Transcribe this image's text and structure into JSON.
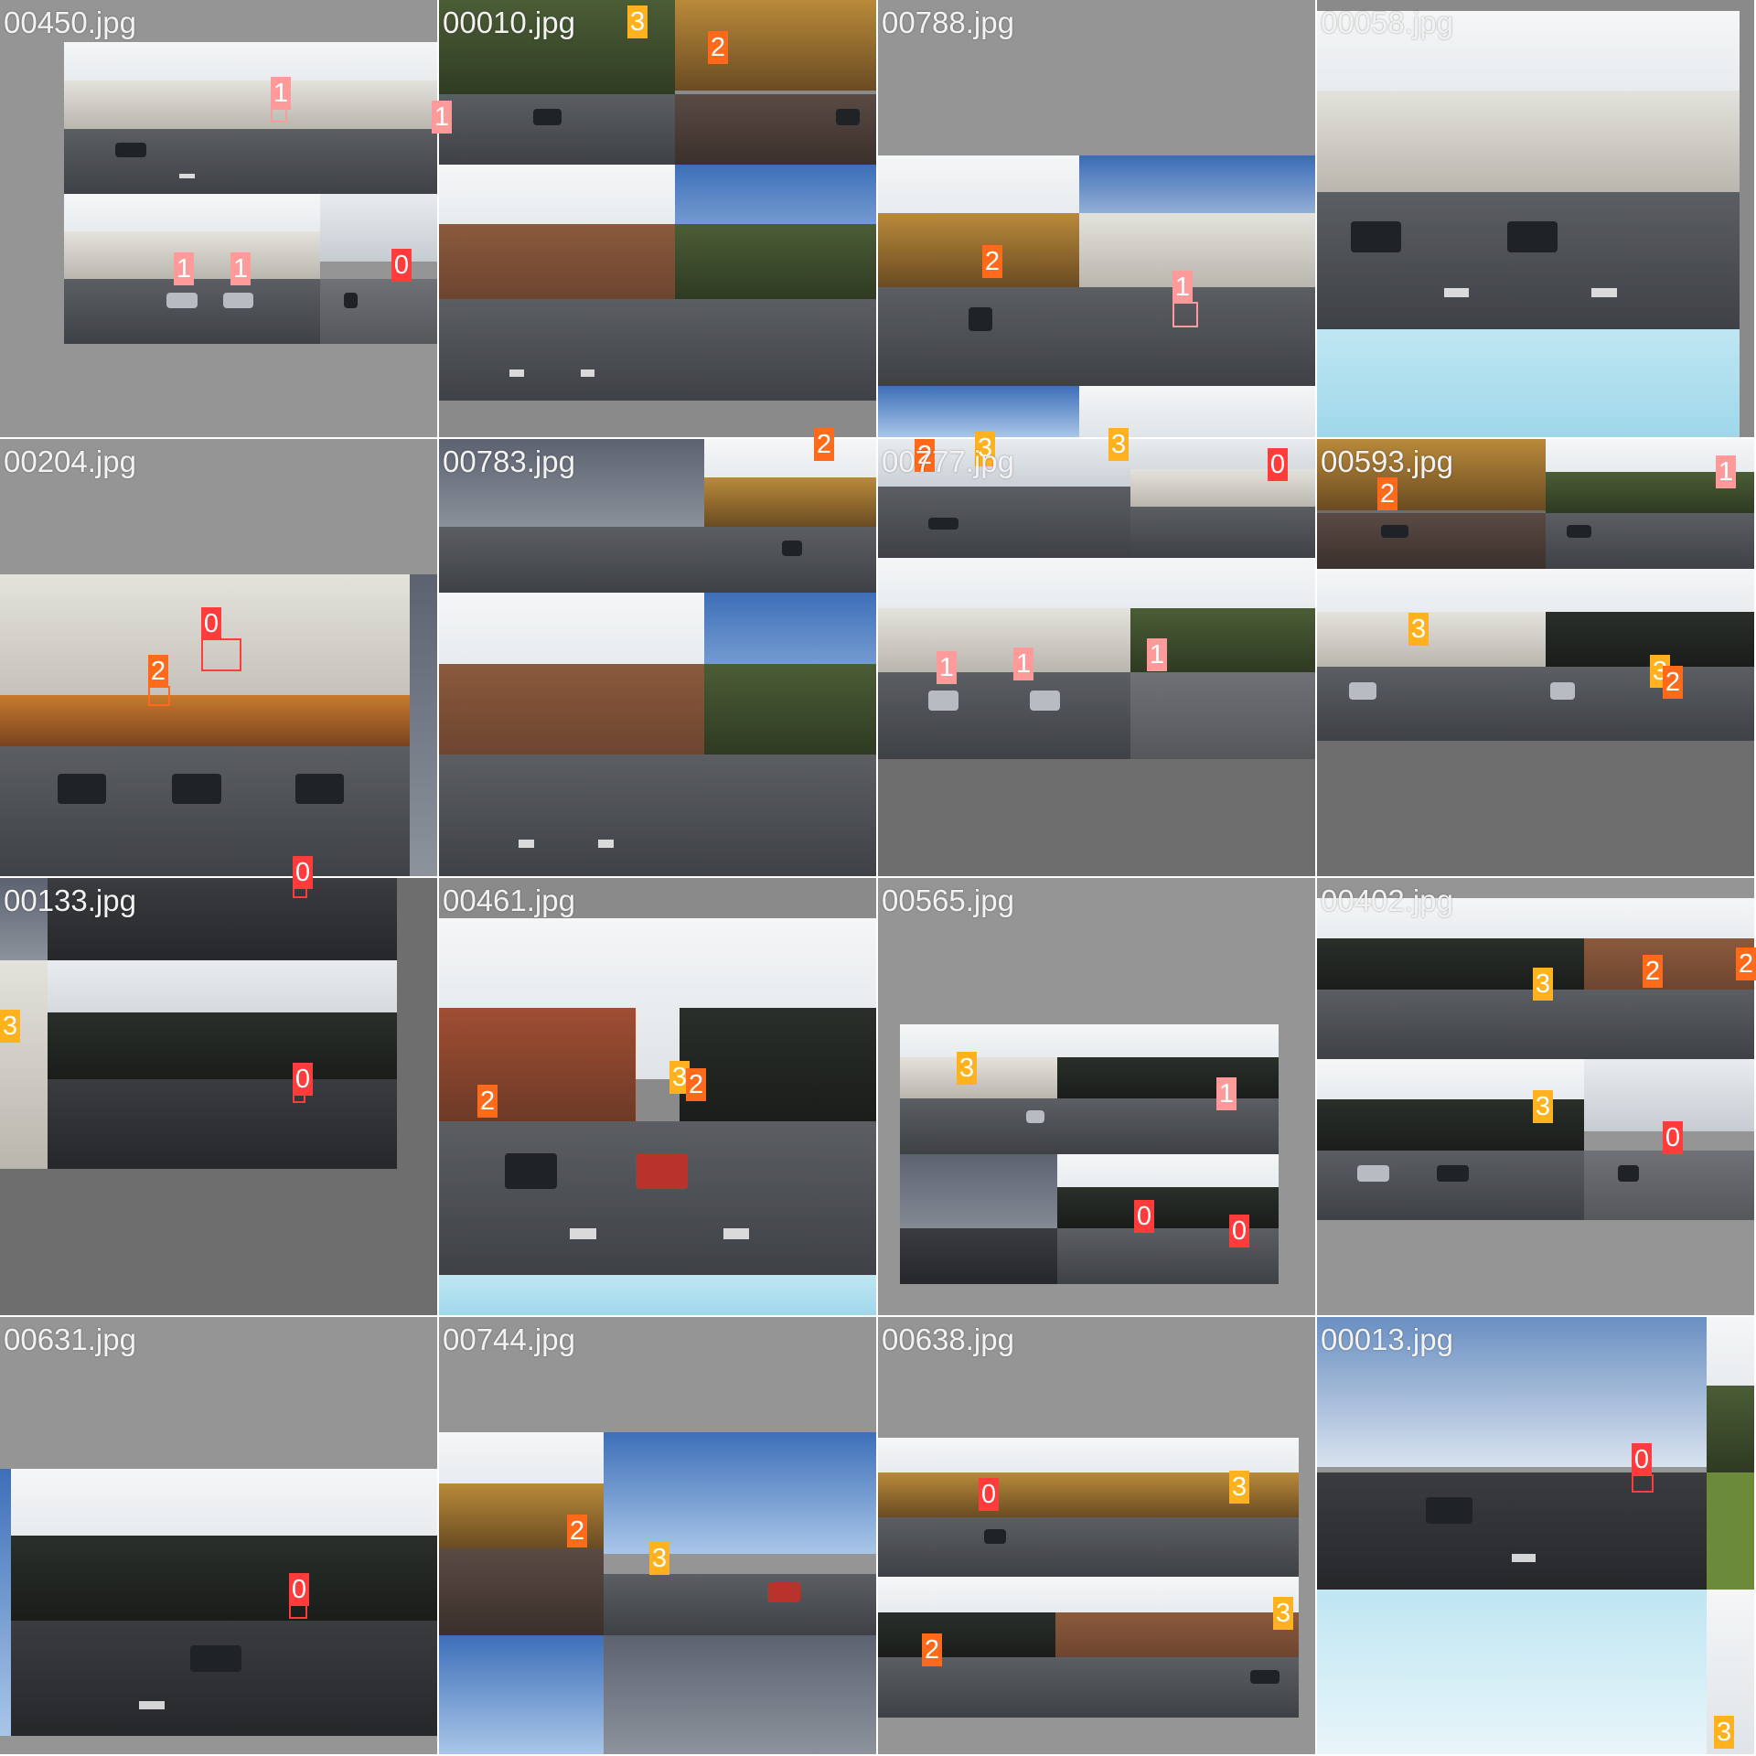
{
  "tiles": [
    {
      "label": "00450.jpg"
    },
    {
      "label": "00010.jpg"
    },
    {
      "label": "00788.jpg"
    },
    {
      "label": "00058.jpg"
    },
    {
      "label": "00204.jpg"
    },
    {
      "label": "00783.jpg"
    },
    {
      "label": "00777.jpg"
    },
    {
      "label": "00593.jpg"
    },
    {
      "label": "00133.jpg"
    },
    {
      "label": "00461.jpg"
    },
    {
      "label": "00565.jpg"
    },
    {
      "label": "00402.jpg"
    },
    {
      "label": "00631.jpg"
    },
    {
      "label": "00744.jpg"
    },
    {
      "label": "00638.jpg"
    },
    {
      "label": "00013.jpg"
    }
  ],
  "markers": [
    {
      "tile": 0,
      "cls": "1"
    },
    {
      "tile": 0,
      "cls": "1"
    },
    {
      "tile": 0,
      "cls": "1"
    },
    {
      "tile": 0,
      "cls": "1"
    },
    {
      "tile": 0,
      "cls": "0"
    },
    {
      "tile": 1,
      "cls": "3"
    },
    {
      "tile": 1,
      "cls": "2"
    },
    {
      "tile": 2,
      "cls": "2"
    },
    {
      "tile": 2,
      "cls": "1"
    },
    {
      "tile": 2,
      "cls": "3"
    },
    {
      "tile": 2,
      "cls": "3"
    },
    {
      "tile": 4,
      "cls": "0"
    },
    {
      "tile": 4,
      "cls": "2"
    },
    {
      "tile": 4,
      "cls": "0"
    },
    {
      "tile": 5,
      "cls": "2"
    },
    {
      "tile": 6,
      "cls": "2"
    },
    {
      "tile": 6,
      "cls": "3"
    },
    {
      "tile": 6,
      "cls": "0"
    },
    {
      "tile": 6,
      "cls": "1"
    },
    {
      "tile": 6,
      "cls": "1"
    },
    {
      "tile": 6,
      "cls": "1"
    },
    {
      "tile": 7,
      "cls": "2"
    },
    {
      "tile": 7,
      "cls": "1"
    },
    {
      "tile": 7,
      "cls": "3"
    },
    {
      "tile": 7,
      "cls": "3"
    },
    {
      "tile": 7,
      "cls": "2"
    },
    {
      "tile": 8,
      "cls": "3"
    },
    {
      "tile": 8,
      "cls": "0"
    },
    {
      "tile": 9,
      "cls": "2"
    },
    {
      "tile": 9,
      "cls": "3"
    },
    {
      "tile": 9,
      "cls": "2"
    },
    {
      "tile": 10,
      "cls": "3"
    },
    {
      "tile": 10,
      "cls": "1"
    },
    {
      "tile": 10,
      "cls": "0"
    },
    {
      "tile": 10,
      "cls": "0"
    },
    {
      "tile": 11,
      "cls": "3"
    },
    {
      "tile": 11,
      "cls": "2"
    },
    {
      "tile": 11,
      "cls": "2"
    },
    {
      "tile": 11,
      "cls": "3"
    },
    {
      "tile": 11,
      "cls": "0"
    },
    {
      "tile": 12,
      "cls": "0"
    },
    {
      "tile": 13,
      "cls": "2"
    },
    {
      "tile": 13,
      "cls": "3"
    },
    {
      "tile": 14,
      "cls": "0"
    },
    {
      "tile": 14,
      "cls": "3"
    },
    {
      "tile": 14,
      "cls": "2"
    },
    {
      "tile": 14,
      "cls": "3"
    },
    {
      "tile": 15,
      "cls": "0"
    },
    {
      "tile": 15,
      "cls": "3"
    }
  ],
  "colors": {
    "class_0": "#ff3b3b",
    "class_1": "#ff9a9a",
    "class_2": "#ff6a1a",
    "class_3": "#ffb21d",
    "padding_grey": "#8a8a8a"
  }
}
